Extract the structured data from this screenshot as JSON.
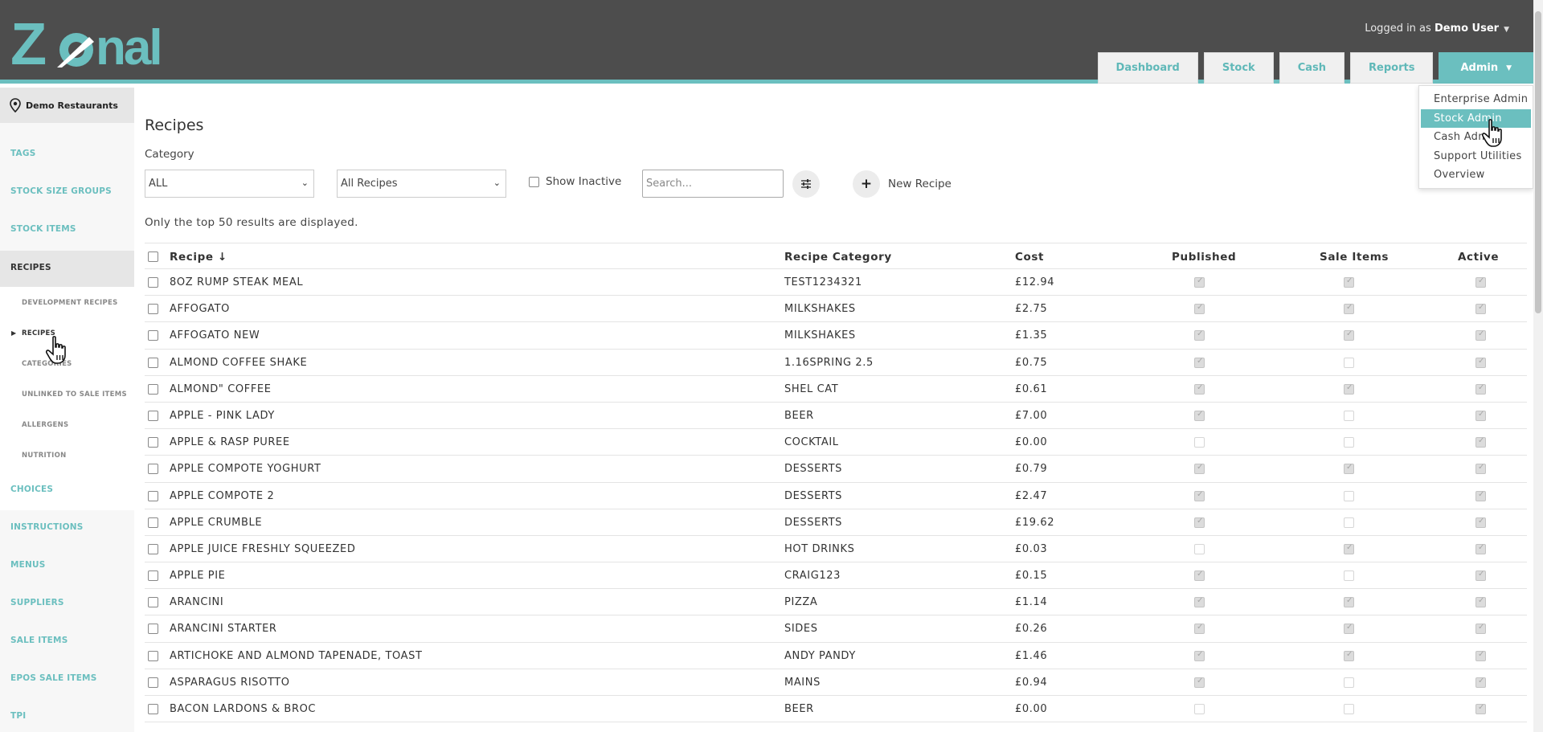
{
  "header": {
    "logo_text": "Zonal",
    "logged_in_prefix": "Logged in as ",
    "user_name": "Demo User",
    "nav": [
      "Dashboard",
      "Stock",
      "Cash",
      "Reports"
    ],
    "admin_label": "Admin"
  },
  "admin_menu": {
    "items": [
      "Enterprise Admin",
      "Stock Admin",
      "Cash Admin",
      "Support Utilities",
      "Overview"
    ],
    "active": "Stock Admin"
  },
  "sidebar": {
    "location": "Demo Restaurants",
    "items": [
      "TAGS",
      "STOCK SIZE GROUPS",
      "STOCK ITEMS",
      "RECIPES",
      "CHOICES",
      "INSTRUCTIONS",
      "MENUS",
      "SUPPLIERS",
      "SALE ITEMS",
      "EPOS SALE ITEMS",
      "TPI"
    ],
    "sub_items": [
      "DEVELOPMENT RECIPES",
      "RECIPES",
      "CATEGORIES",
      "UNLINKED TO SALE ITEMS",
      "ALLERGENS",
      "NUTRITION"
    ],
    "active_item": "RECIPES",
    "active_sub": "RECIPES"
  },
  "page": {
    "title": "Recipes",
    "category_label": "Category",
    "category_value": "ALL",
    "recipe_filter_value": "All Recipes",
    "show_inactive_label": "Show Inactive",
    "search_placeholder": "Search...",
    "new_recipe_label": "New Recipe",
    "notice": "Only the top 50 results are displayed."
  },
  "table": {
    "columns": [
      "Recipe",
      "Recipe Category",
      "Cost",
      "Published",
      "Sale Items",
      "Active"
    ],
    "sort_indicator": "↓",
    "rows": [
      {
        "name": "8OZ RUMP STEAK MEAL",
        "category": "TEST1234321",
        "cost": "£12.94",
        "published": true,
        "sale_items": true,
        "active": true
      },
      {
        "name": "AFFOGATO",
        "category": "MILKSHAKES",
        "cost": "£2.75",
        "published": true,
        "sale_items": true,
        "active": true
      },
      {
        "name": "AFFOGATO NEW",
        "category": "MILKSHAKES",
        "cost": "£1.35",
        "published": true,
        "sale_items": true,
        "active": true
      },
      {
        "name": "ALMOND COFFEE SHAKE",
        "category": "1.16SPRING 2.5",
        "cost": "£0.75",
        "published": true,
        "sale_items": false,
        "active": true
      },
      {
        "name": "ALMOND\" COFFEE",
        "category": "SHEL CAT",
        "cost": "£0.61",
        "published": true,
        "sale_items": true,
        "active": true
      },
      {
        "name": "APPLE - PINK LADY",
        "category": "BEER",
        "cost": "£7.00",
        "published": true,
        "sale_items": false,
        "active": true
      },
      {
        "name": "APPLE & RASP PUREE",
        "category": "COCKTAIL",
        "cost": "£0.00",
        "published": false,
        "sale_items": false,
        "active": true
      },
      {
        "name": "APPLE COMPOTE YOGHURT",
        "category": "DESSERTS",
        "cost": "£0.79",
        "published": true,
        "sale_items": true,
        "active": true
      },
      {
        "name": "APPLE COMPOTE 2",
        "category": "DESSERTS",
        "cost": "£2.47",
        "published": true,
        "sale_items": false,
        "active": true
      },
      {
        "name": "APPLE CRUMBLE",
        "category": "DESSERTS",
        "cost": "£19.62",
        "published": true,
        "sale_items": false,
        "active": true
      },
      {
        "name": "APPLE JUICE FRESHLY SQUEEZED",
        "category": "HOT DRINKS",
        "cost": "£0.03",
        "published": false,
        "sale_items": true,
        "active": true
      },
      {
        "name": "APPLE PIE",
        "category": "CRAIG123",
        "cost": "£0.15",
        "published": true,
        "sale_items": false,
        "active": true
      },
      {
        "name": "ARANCINI",
        "category": "PIZZA",
        "cost": "£1.14",
        "published": true,
        "sale_items": true,
        "active": true
      },
      {
        "name": "ARANCINI STARTER",
        "category": "SIDES",
        "cost": "£0.26",
        "published": true,
        "sale_items": true,
        "active": true
      },
      {
        "name": "ARTICHOKE AND ALMOND TAPENADE, TOAST",
        "category": "ANDY PANDY",
        "cost": "£1.46",
        "published": true,
        "sale_items": true,
        "active": true
      },
      {
        "name": "ASPARAGUS RISOTTO",
        "category": "MAINS",
        "cost": "£0.94",
        "published": true,
        "sale_items": false,
        "active": true
      },
      {
        "name": "BACON LARDONS & BROC",
        "category": "BEER",
        "cost": "£0.00",
        "published": false,
        "sale_items": false,
        "active": true
      }
    ]
  },
  "colors": {
    "header_bg": "#4d4d4d",
    "accent": "#6bbfbf"
  }
}
